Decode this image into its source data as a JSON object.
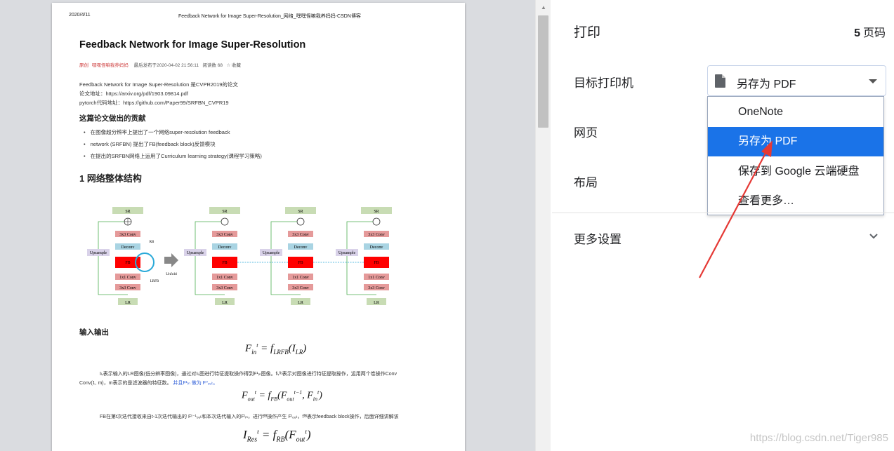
{
  "preview": {
    "header_date": "2020/4/11",
    "header_title": "Feedback Network for Image Super-Resolution_网络_嘿嘿怪嘛我养妈妈-CSDN博客",
    "doc_title": "Feedback Network for Image Super-Resolution",
    "meta": {
      "mark": "原创",
      "author": "嘿嘿怪嘛我养妈妈",
      "published": "最后发布于2020-04-02 21:56:11",
      "reads": "阅读数 68",
      "favorite": "☆ 收藏"
    },
    "intro_lines": [
      "Feedback Network for Image Super-Resolution 是CVPR2019的论文",
      "论文地址：https://arxiv.org/pdf/1903.09814.pdf",
      "pytorch代码地址：https://github.com/Paper99/SRFBN_CVPR19"
    ],
    "section_contrib": "这篇论文做出的贡献",
    "bullets": [
      "在图像超分辨率上提出了一个网络super-resolution feedback",
      "network (SRFBN) 提出了FB(feedback block)反馈模块",
      "在提出的SRFBN网络上运用了Curriculum learning strategy(课程学习策略)"
    ],
    "section_net": "1 网络整体结构",
    "figure": {
      "labels": {
        "sr": "SR",
        "lr": "LR",
        "upsample": "Upsample",
        "conv3": "3x3 Conv",
        "conv1": "1x1 Conv",
        "deconv": "Deconv",
        "fb": "FB",
        "rb": "RB",
        "lrfb": "LRFB",
        "unfold": "Unfold"
      }
    },
    "section_io": "输入输出",
    "formula1": "F",
    "para1": "Iₗᵣ表示输入的LR图像(低分辨率图像)，通过对Iₗᵣ图进行特征提取操作得到F¹ᵢₙ图像。fₗᵣᶠᵇ表示对图像进行特征提取操作，运用两个卷操作Conv",
    "para1b": "Conv(1, m)，m表示的是滤波器的特征数。",
    "para1_link": "并且F¹ᵢₙ 做为 F⁰ₒᵤₜ。",
    "para2": "FB在第t次迭代接收来自t-1次迭代输出的 Fᵗ⁻¹ₒᵤₜ和本次迭代输入的Fᵗᵢₙ，进行fᶠᴮ操作产生 Fᵗₒᵤₜ，fᶠᴮ表示feedback block操作，后面详细讲解该"
  },
  "scrollbar": {
    "up_arrow": "▲"
  },
  "settings": {
    "title": "打印",
    "page_count_num": "5",
    "page_count_unit": "页码",
    "destination_label": "目标打印机",
    "destination_value": "另存为 PDF",
    "pages_label": "网页",
    "layout_label": "布局",
    "more_settings": "更多设置",
    "destination_options": [
      {
        "label": "OneNote",
        "selected": false
      },
      {
        "label": "另存为 PDF",
        "selected": true
      },
      {
        "label": "保存到 Google 云端硬盘",
        "selected": false
      },
      {
        "label": "查看更多…",
        "selected": false
      }
    ]
  },
  "watermark": "https://blog.csdn.net/Tiger985",
  "colors": {
    "accent": "#1a73e8",
    "annotation_arrow": "#e53935",
    "fb_red": "#ff0000",
    "conv_pink": "#e59a9a",
    "deconv_blue": "#a9d4e3",
    "sr_green": "#c8dcb4",
    "upsample_purple": "#d9d2e9"
  }
}
